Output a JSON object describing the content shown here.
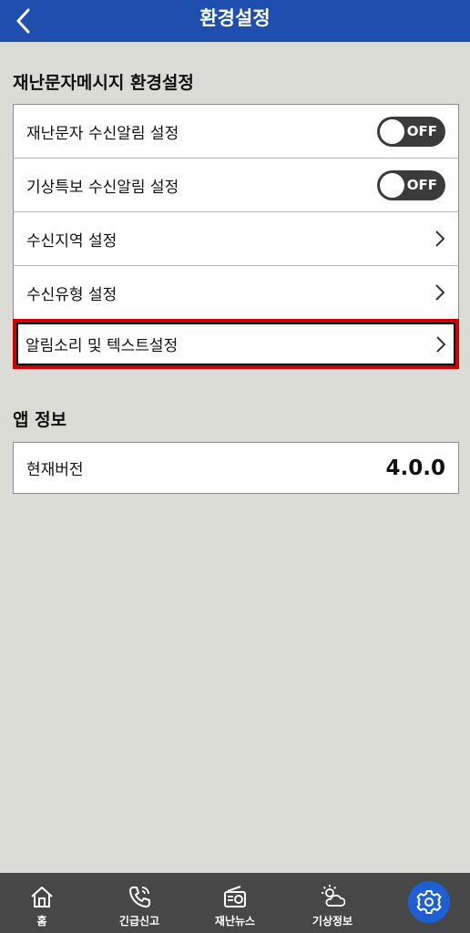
{
  "header": {
    "title": "환경설정",
    "back_icon": "chevron-left-icon"
  },
  "disaster_settings": {
    "section_title": "재난문자메시지 환경설정",
    "rows": [
      {
        "label": "재난문자 수신알림 설정",
        "control": "toggle",
        "state": "OFF"
      },
      {
        "label": "기상특보 수신알림 설정",
        "control": "toggle",
        "state": "OFF"
      },
      {
        "label": "수신지역 설정",
        "control": "chevron-right-icon"
      },
      {
        "label": "수신유형 설정",
        "control": "chevron-right-icon"
      },
      {
        "label": "알림소리 및 텍스트설정",
        "control": "chevron-right-icon",
        "highlighted": true
      }
    ]
  },
  "app_info": {
    "section_title": "앱 정보",
    "version_label": "현재버전",
    "version_value": "4.0.0"
  },
  "bottom_nav": {
    "items": [
      {
        "label": "홈",
        "icon": "home-icon"
      },
      {
        "label": "긴급신고",
        "icon": "phone-icon"
      },
      {
        "label": "재난뉴스",
        "icon": "radio-icon"
      },
      {
        "label": "기상정보",
        "icon": "weather-icon"
      }
    ],
    "settings_icon": "gear-icon"
  },
  "colors": {
    "header": "#1f4fae",
    "background": "#dcdcd7",
    "highlight": "#d10000",
    "bottom_bar": "#474747",
    "settings_button": "#1f5fd6"
  }
}
